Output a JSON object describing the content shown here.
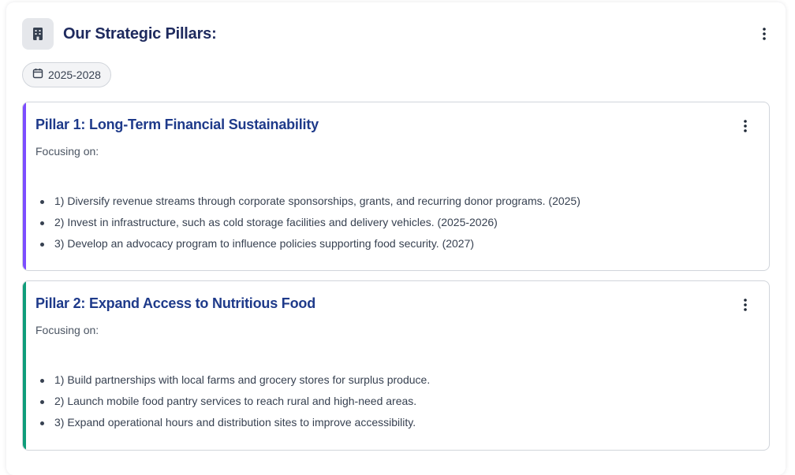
{
  "header": {
    "title": "Our Strategic Pillars:",
    "icon": "building-icon",
    "menu_icon": "more-vertical-icon"
  },
  "period_chip": {
    "icon": "calendar-icon",
    "label": "2025-2028"
  },
  "pillars": [
    {
      "title": "Pillar 1: Long-Term Financial Sustainability",
      "accent_color": "#7c4dff",
      "focus_label": "Focusing on:",
      "items": [
        "1) Diversify revenue streams through corporate sponsorships, grants, and recurring donor programs. (2025)",
        "2) Invest in infrastructure, such as cold storage facilities and delivery vehicles. (2025-2026)",
        "3) Develop an advocacy program to influence policies supporting food security. (2027)"
      ]
    },
    {
      "title": "Pillar 2: Expand Access to Nutritious Food",
      "accent_color": "#0f9d7a",
      "focus_label": "Focusing on:",
      "items": [
        "1) Build partnerships with local farms and grocery stores for surplus produce.",
        "2) Launch mobile food pantry services to reach rural and high-need areas.",
        "3) Expand operational hours and distribution sites to improve accessibility."
      ]
    }
  ],
  "colors": {
    "title_text": "#1e2a5e",
    "pillar_title_text": "#1e3a8a",
    "body_text": "#374151"
  }
}
